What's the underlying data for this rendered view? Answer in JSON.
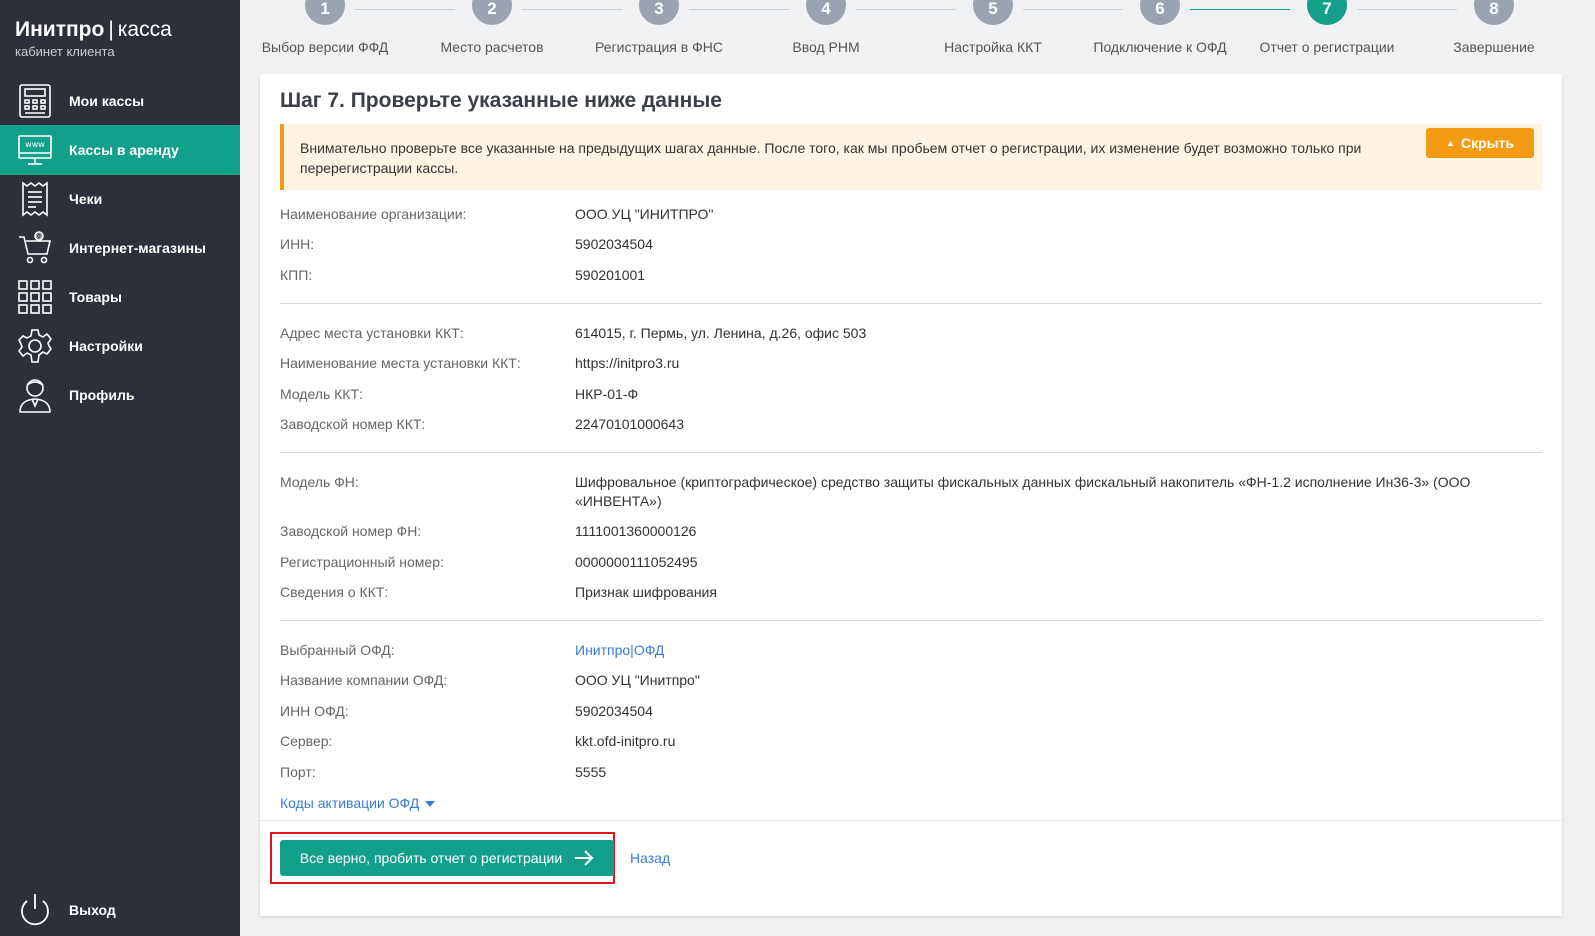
{
  "brand": {
    "name": "Инитпро",
    "separator": "|",
    "product": "касса",
    "subtitle": "кабинет клиента"
  },
  "colors": {
    "sidebar": "#2c3038",
    "accent": "#13a08a",
    "warning": "#f39c12",
    "link": "#3a7bd5",
    "highlight": "#e2141b"
  },
  "sidebar": {
    "items": [
      {
        "label": "Мои кассы",
        "icon": "cash-register-icon",
        "active": false
      },
      {
        "label": "Кассы в аренду",
        "icon": "monitor-www-icon",
        "active": true
      },
      {
        "label": "Чеки",
        "icon": "receipt-icon",
        "active": false
      },
      {
        "label": "Интернет-магазины",
        "icon": "cart-icon",
        "active": false
      },
      {
        "label": "Товары",
        "icon": "grid-icon",
        "active": false
      },
      {
        "label": "Настройки",
        "icon": "gear-icon",
        "active": false
      },
      {
        "label": "Профиль",
        "icon": "user-icon",
        "active": false
      }
    ],
    "logout": {
      "label": "Выход",
      "icon": "power-icon"
    }
  },
  "stepper": {
    "current": 7,
    "steps": [
      {
        "num": "1",
        "label": "Выбор версии ФФД"
      },
      {
        "num": "2",
        "label": "Место расчетов"
      },
      {
        "num": "3",
        "label": "Регистрация в ФНС"
      },
      {
        "num": "4",
        "label": "Ввод РНМ"
      },
      {
        "num": "5",
        "label": "Настройка ККТ"
      },
      {
        "num": "6",
        "label": "Подключение к ОФД"
      },
      {
        "num": "7",
        "label": "Отчет о регистрации"
      },
      {
        "num": "8",
        "label": "Завершение"
      }
    ]
  },
  "card": {
    "title": "Шаг 7. Проверьте указанные ниже данные",
    "alert": {
      "text": "Внимательно проверьте все указанные на предыдущих шагах данные. После того, как мы пробьем отчет о регистрации, их изменение будет возможно только при перерегистрации кассы.",
      "hide_label": "Скрыть"
    },
    "org": [
      {
        "label": "Наименование организации:",
        "value": "ООО УЦ \"ИНИТПРО\""
      },
      {
        "label": "ИНН:",
        "value": "5902034504"
      },
      {
        "label": "КПП:",
        "value": "590201001"
      }
    ],
    "kkt": [
      {
        "label": "Адрес места установки ККТ:",
        "value": "614015, г. Пермь, ул. Ленина, д.26, офис 503"
      },
      {
        "label": "Наименование места установки ККТ:",
        "value": "https://initpro3.ru"
      },
      {
        "label": "Модель ККТ:",
        "value": "НКР-01-Ф"
      },
      {
        "label": "Заводской номер ККТ:",
        "value": "22470101000643"
      }
    ],
    "fn": [
      {
        "label": "Модель ФН:",
        "value": "Шифровальное (криптографическое) средство защиты фискальных данных фискальный накопитель «ФН-1.2 исполнение Ин36-3» (ООО «ИНВЕНТА»)"
      },
      {
        "label": "Заводской номер ФН:",
        "value": "1111001360000126"
      },
      {
        "label": "Регистрационный номер:",
        "value": "0000000111052495"
      },
      {
        "label": "Сведения о ККТ:",
        "value": "Признак шифрования"
      }
    ],
    "ofd": [
      {
        "label": "Выбранный ОФД:",
        "value": "Инитпро|ОФД"
      },
      {
        "label": "Название компании ОФД:",
        "value": "ООО УЦ \"Инитпро\""
      },
      {
        "label": "ИНН ОФД:",
        "value": "5902034504"
      },
      {
        "label": "Сервер:",
        "value": "kkt.ofd-initpro.ru"
      },
      {
        "label": "Порт:",
        "value": "5555"
      }
    ],
    "codes_link": "Коды активации ОФД",
    "submit_label": "Все верно, пробить отчет о регистрации",
    "back_label": "Назад"
  }
}
